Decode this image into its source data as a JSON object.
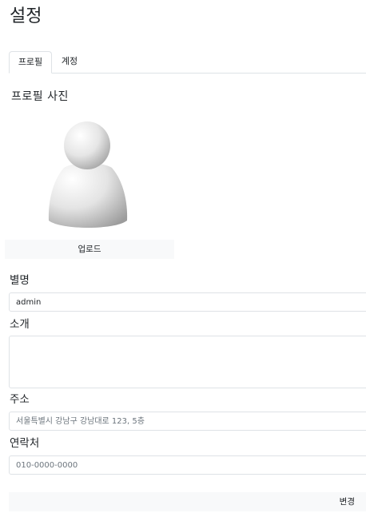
{
  "page": {
    "title": "설정"
  },
  "tabs": [
    {
      "label": "프로필",
      "active": true
    },
    {
      "label": "계정",
      "active": false
    }
  ],
  "profile": {
    "photo_section_title": "프로필 사진",
    "avatar_icon": "default-user-avatar-icon",
    "upload_label": "업로드"
  },
  "form": {
    "nickname": {
      "label": "별명",
      "value": "admin"
    },
    "intro": {
      "label": "소개",
      "value": ""
    },
    "address": {
      "label": "주소",
      "placeholder": "서울특별시 강남구 강남대로 123, 5층"
    },
    "contact": {
      "label": "연락처",
      "placeholder": "010-0000-0000"
    },
    "submit_label": "변경"
  },
  "colors": {
    "border": "#dee2e6",
    "button_bg": "#f8f9fa",
    "text": "#212529",
    "placeholder": "#6c757d"
  }
}
